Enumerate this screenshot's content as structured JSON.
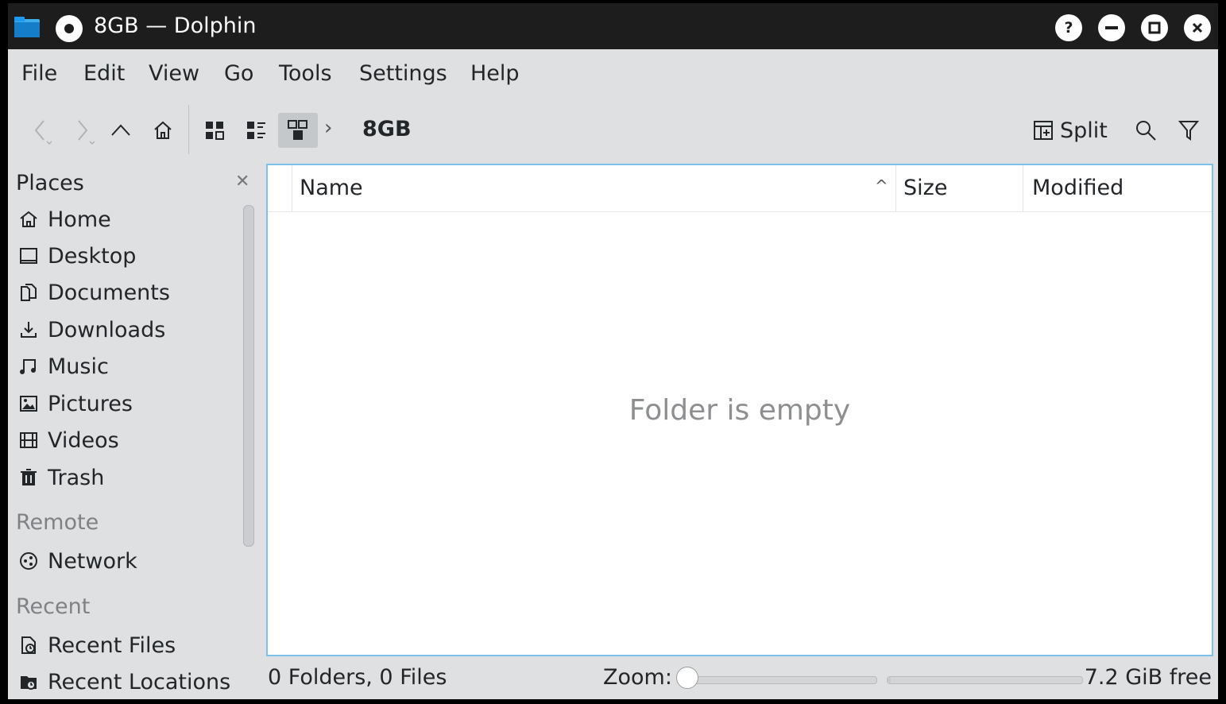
{
  "window": {
    "title": "8GB — Dolphin"
  },
  "menubar": [
    "File",
    "Edit",
    "View",
    "Go",
    "Tools",
    "Settings",
    "Help"
  ],
  "toolbar": {
    "breadcrumb": "8GB",
    "split_label": "Split"
  },
  "places": {
    "title": "Places",
    "items": [
      {
        "label": "Home",
        "icon": "home-icon"
      },
      {
        "label": "Desktop",
        "icon": "desktop-icon"
      },
      {
        "label": "Documents",
        "icon": "documents-icon"
      },
      {
        "label": "Downloads",
        "icon": "downloads-icon"
      },
      {
        "label": "Music",
        "icon": "music-icon"
      },
      {
        "label": "Pictures",
        "icon": "pictures-icon"
      },
      {
        "label": "Videos",
        "icon": "videos-icon"
      },
      {
        "label": "Trash",
        "icon": "trash-icon"
      }
    ],
    "remote_title": "Remote",
    "remote_items": [
      {
        "label": "Network",
        "icon": "network-icon"
      }
    ],
    "recent_title": "Recent",
    "recent_items": [
      {
        "label": "Recent Files",
        "icon": "recent-files-icon"
      },
      {
        "label": "Recent Locations",
        "icon": "recent-locations-icon"
      }
    ]
  },
  "columns": {
    "name": "Name",
    "size": "Size",
    "modified": "Modified"
  },
  "content": {
    "empty_message": "Folder is empty"
  },
  "statusbar": {
    "summary": "0 Folders, 0 Files",
    "zoom_label": "Zoom:",
    "zoom_level": 0,
    "free_space": "7.2 GiB free"
  },
  "colors": {
    "titlebar": "#1d1d1d",
    "accent_border": "#7ec1e8",
    "panel": "#dee0e2"
  }
}
